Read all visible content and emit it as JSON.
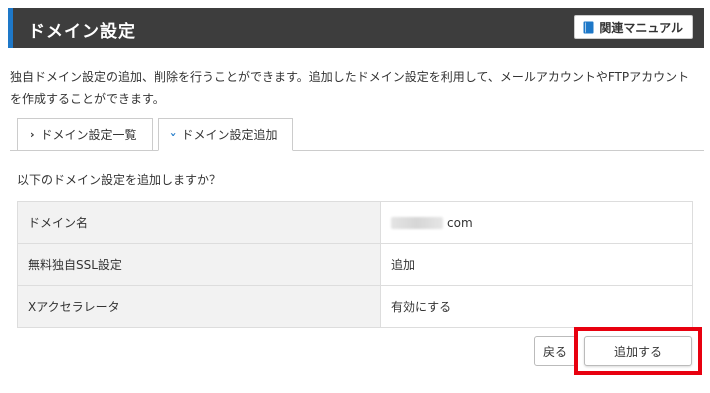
{
  "header": {
    "title": "ドメイン設定",
    "manual_label": "関連マニュアル"
  },
  "description": "独自ドメイン設定の追加、削除を行うことができます。追加したドメイン設定を利用して、メールアカウントやFTPアカウントを作成することができます。",
  "tabs": [
    {
      "label": "ドメイン設定一覧",
      "active": false,
      "icon": "chevron-right-icon"
    },
    {
      "label": "ドメイン設定追加",
      "active": true,
      "icon": "chevron-down-icon"
    }
  ],
  "confirm": {
    "question": "以下のドメイン設定を追加しますか？",
    "rows": [
      {
        "label": "ドメイン名",
        "value": "com"
      },
      {
        "label": "無料独自SSL設定",
        "value": "追加"
      },
      {
        "label": "Xアクセラレータ",
        "value": "有効にする"
      }
    ]
  },
  "actions": {
    "back_label": "戻る",
    "submit_label": "追加する"
  },
  "colors": {
    "header_bg": "#3d3d3d",
    "accent": "#1e78c8",
    "highlight": "#e8000f"
  }
}
